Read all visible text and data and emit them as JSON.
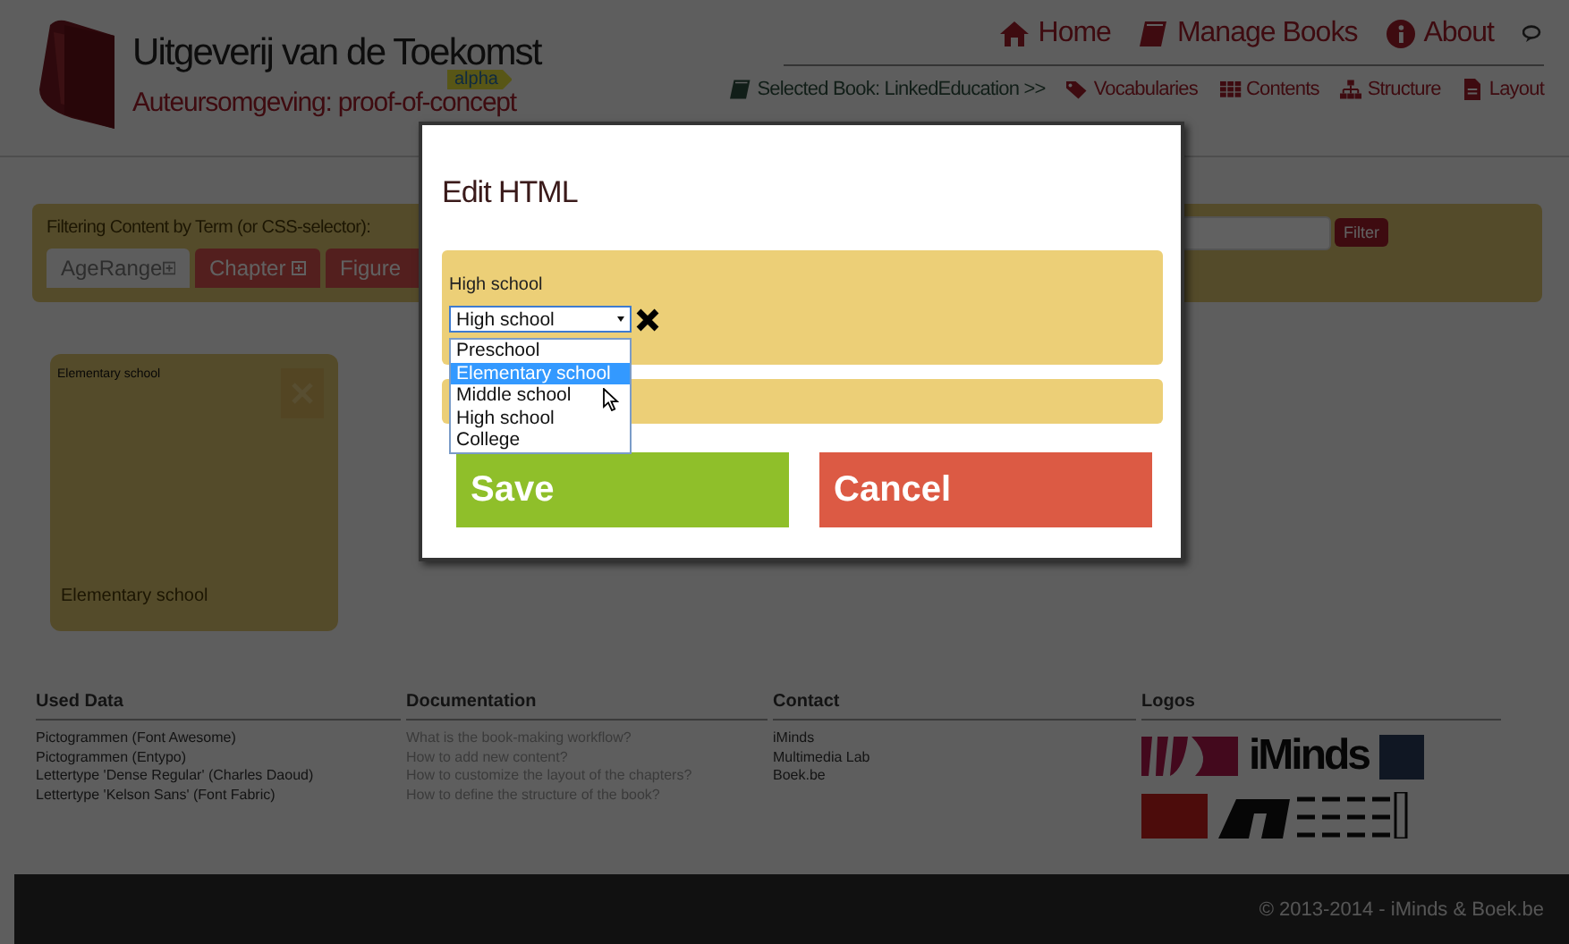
{
  "header": {
    "title": "Uitgeverij van de Toekomst",
    "subtitle": "Auteursomgeving: proof-of-concept",
    "badge": "alpha"
  },
  "nav_main": [
    {
      "label": "Home",
      "kind": "home"
    },
    {
      "label": "Manage Books",
      "kind": "book"
    },
    {
      "label": "About",
      "kind": "info"
    }
  ],
  "nav_book": [
    {
      "label": "Selected Book: LinkedEducation >>",
      "kind": "book"
    },
    {
      "label": "Vocabularies",
      "kind": "tag"
    },
    {
      "label": "Contents",
      "kind": "grid"
    },
    {
      "label": "Structure",
      "kind": "tree"
    },
    {
      "label": "Layout",
      "kind": "file"
    }
  ],
  "filter": {
    "label": "Filtering Content by Term (or CSS-selector):",
    "button": "Filter",
    "tabs": [
      {
        "label": "AgeRange",
        "selected": true
      },
      {
        "label": "Chapter",
        "selected": false
      },
      {
        "label": "Figure",
        "selected": false
      }
    ]
  },
  "card": {
    "title": "Elementary school",
    "caption": "Elementary school"
  },
  "footer": [
    {
      "heading": "Used Data",
      "kind": "text",
      "items": [
        "Pictogrammen (Font Awesome)",
        "Pictogrammen (Entypo)",
        "Lettertype 'Dense Regular' (Charles Daoud)",
        "Lettertype 'Kelson Sans' (Font Fabric)"
      ]
    },
    {
      "heading": "Documentation",
      "kind": "link",
      "items": [
        "What is the book-making workflow?",
        "How to add new content?",
        "How to customize the layout of the chapters?",
        "How to define the structure of the book?"
      ]
    },
    {
      "heading": "Contact",
      "kind": "text",
      "items": [
        "iMinds",
        "Multimedia Lab",
        "Boek.be"
      ]
    },
    {
      "heading": "Logos",
      "kind": "logos",
      "items": [
        "iMinds"
      ]
    }
  ],
  "copyright": "© 2013-2014 - iMinds & Boek.be",
  "modal": {
    "title": "Edit HTML",
    "field_label": "High school",
    "select": {
      "value": "High school",
      "expanded": true,
      "options": [
        {
          "label": "Preschool",
          "highlighted": false
        },
        {
          "label": "Elementary school",
          "highlighted": true
        },
        {
          "label": "Middle school",
          "highlighted": false
        },
        {
          "label": "High school",
          "highlighted": false
        },
        {
          "label": "College",
          "highlighted": false
        }
      ]
    },
    "buttons": [
      {
        "label": "Save",
        "kind": "save"
      },
      {
        "label": "Cancel",
        "kind": "cancel"
      }
    ]
  }
}
